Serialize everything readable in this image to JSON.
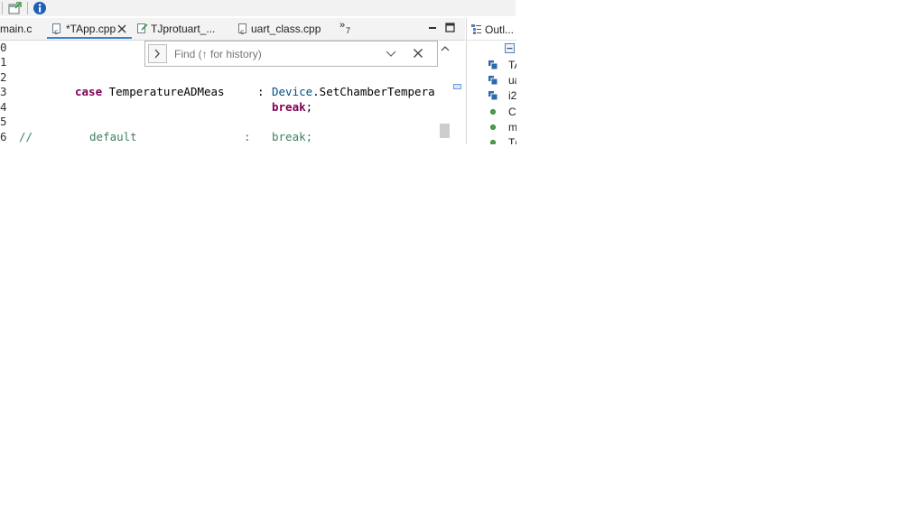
{
  "tabs": [
    {
      "label": "main.c"
    },
    {
      "label": "*TApp.cpp"
    },
    {
      "label": "TJprotuart_..."
    },
    {
      "label": "uart_class.cpp"
    }
  ],
  "overflow": {
    "count": "7"
  },
  "editor": {
    "line_numbers": [
      "0",
      "1",
      "2",
      "3",
      "4",
      "5",
      "6"
    ],
    "lines": {
      "l3_kw": "case",
      "l3_name": " TemperatureADMeas",
      "l3_colon": "  :   ",
      "l3_obj": "Device",
      "l3_call": ".SetChamberTempera",
      "l4_kw": "break",
      "l4_semi": ";",
      "l6_cmt": "//",
      "l6_default": "default",
      "l6_colon": ":",
      "l6_break": "break;"
    }
  },
  "find": {
    "placeholder": "Find (↑ for history)"
  },
  "outline": {
    "title": "Outl...",
    "items": [
      {
        "label": "TA",
        "icon": "struct-icon"
      },
      {
        "label": "ua",
        "icon": "struct-icon"
      },
      {
        "label": "i2",
        "icon": "struct-icon"
      },
      {
        "label": "Cp",
        "icon": "function-icon"
      },
      {
        "label": "m",
        "icon": "function-icon"
      },
      {
        "label": "T(",
        "icon": "function-icon"
      }
    ]
  },
  "colors": {
    "keyword": "#7f0055",
    "comment": "#3f7f5f",
    "accent": "#3b7fd0"
  }
}
